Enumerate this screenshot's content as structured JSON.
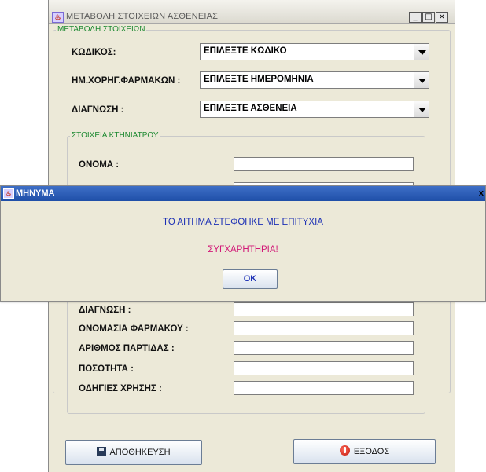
{
  "window": {
    "title": "ΜΕΤΑΒΟΛΗ ΣΤΟΙΧΕΙΩΝ ΑΣΘΕΝΕΙΑΣ",
    "controls": {
      "minimize": "_",
      "maximize": "□",
      "close": "×"
    }
  },
  "change_group": {
    "legend": "ΜΕΤΑΒΟΛΗ ΣΤΟΙΧΕΙΩΝ",
    "fields": [
      {
        "label": "ΚΩΔΙΚΟΣ:",
        "value": "ΕΠΙΛΕΞΤΕ ΚΩΔΙΚΟ"
      },
      {
        "label": "ΗΜ.ΧΟΡΗΓ.ΦΑΡΜΑΚΩΝ :",
        "value": "ΕΠΙΛΕΞΤΕ ΗΜΕΡΟΜΗΝΙΑ"
      },
      {
        "label": "ΔΙΑΓΝΩΣΗ :",
        "value": "ΕΠΙΛΕΞΤΕ ΑΣΘΕΝΕΙΑ"
      }
    ]
  },
  "vet_group": {
    "legend": "ΣΤΟΙΧΕΙΑ ΚΤΗΝΙΑΤΡΟΥ",
    "fields": [
      {
        "label": "ΟΝΟΜΑ :",
        "value": ""
      },
      {
        "label": "ΔΙΑΓΝΩΣΗ :",
        "value": ""
      },
      {
        "label": "ΟΝΟΜΑΣΙΑ ΦΑΡΜΑΚΟΥ :",
        "value": ""
      },
      {
        "label": "ΑΡΙΘΜΟΣ ΠΑΡΤΙΔΑΣ :",
        "value": ""
      },
      {
        "label": "ΠΟΣΟΤΗΤΑ :",
        "value": ""
      },
      {
        "label": "ΟΔΗΓΙΕΣ ΧΡΗΣΗΣ :",
        "value": ""
      }
    ]
  },
  "buttons": {
    "save": "ΑΠΟΘΗΚΕΥΣΗ",
    "exit": "ΕΞΟΔΟΣ"
  },
  "dialog": {
    "title": "ΜΗΝΥΜΑ",
    "close": "x",
    "message": "ΤΟ ΑΙΤΗΜΑ ΣΤΕΦΘΗΚΕ ΜΕ ΕΠΙΤΥΧΙΑ",
    "congrats": "ΣΥΓΧΑΡΗΤΗΡΙΑ!",
    "ok": "OK"
  },
  "colors": {
    "legend": "#1e8a32",
    "message": "#1b2fb5",
    "congrats": "#d21a78",
    "dialog_title_bar": "#2a5bb8"
  }
}
